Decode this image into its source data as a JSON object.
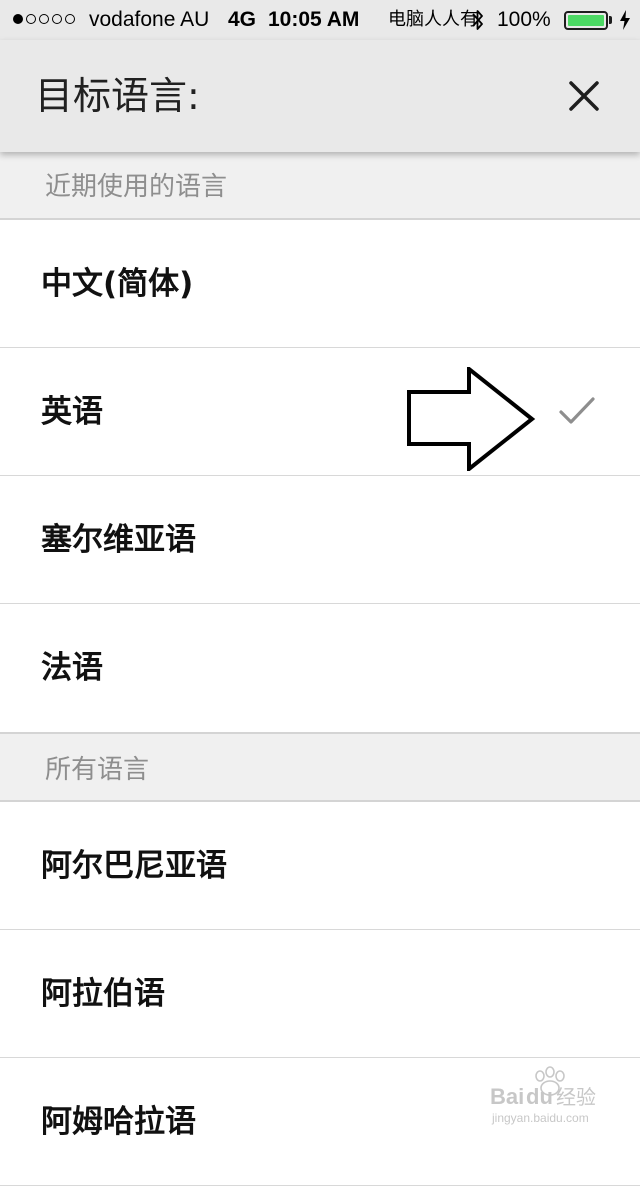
{
  "status_bar": {
    "carrier": "vodafone AU",
    "network": "4G",
    "time": "10:05 AM",
    "overlay_text": "电脑人人有",
    "battery_percent": "100%",
    "battery_level": 1.0,
    "battery_color": "#4cd964",
    "signal_bars": 1,
    "signal_total": 5,
    "icons": [
      "signal-dots-icon",
      "bluetooth-icon",
      "battery-icon",
      "charging-icon"
    ]
  },
  "header": {
    "title": "目标语言:",
    "close_icon": "close-icon"
  },
  "sections": [
    {
      "title": "近期使用的语言",
      "items": [
        {
          "label": "中文(简体)",
          "selected": false
        },
        {
          "label": "英语",
          "selected": true
        },
        {
          "label": "塞尔维亚语",
          "selected": false
        },
        {
          "label": "法语",
          "selected": false
        }
      ]
    },
    {
      "title": "所有语言",
      "items": [
        {
          "label": "阿尔巴尼亚语",
          "selected": false
        },
        {
          "label": "阿拉伯语",
          "selected": false
        },
        {
          "label": "阿姆哈拉语",
          "selected": false
        }
      ]
    }
  ],
  "annotation": {
    "icon": "right-arrow-annotation-icon"
  },
  "watermark": {
    "logo_text": "Baidu经验",
    "url_text": "jingyan.baidu.com"
  },
  "colors": {
    "header_bg": "#e9e9e9",
    "section_bg": "#f0f0f0",
    "section_text": "#8e8e8e",
    "check": "#8e8e8e",
    "divider": "#d8d8d8"
  }
}
